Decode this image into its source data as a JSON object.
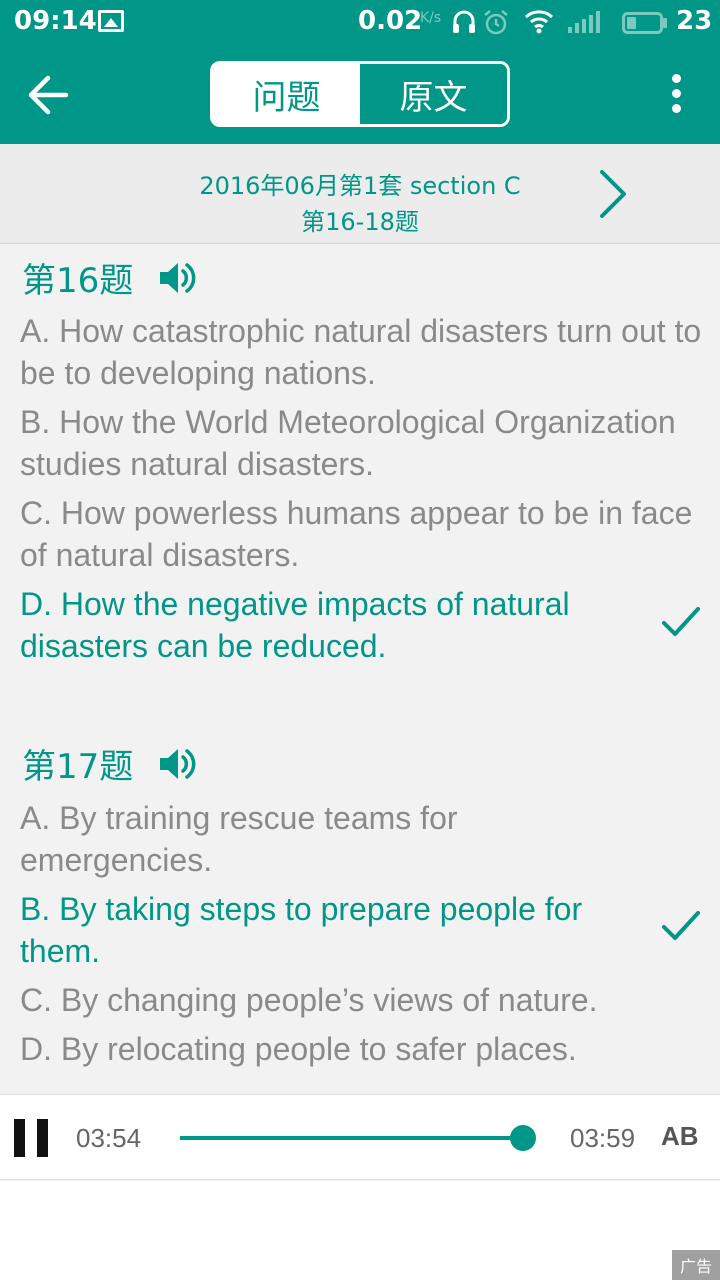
{
  "status_bar": {
    "time": "09:14",
    "net_speed": "0.02",
    "net_speed_unit": "K/s",
    "battery": "23"
  },
  "app_bar": {
    "tabs": [
      {
        "label": "问题",
        "active": true
      },
      {
        "label": "原文",
        "active": false
      }
    ]
  },
  "section": {
    "title": "2016年06月第1套 section C",
    "subtitle": "第16-18题"
  },
  "questions": [
    {
      "title": "第16题",
      "options": [
        {
          "text": "A. How catastrophic natural disasters turn out to be to developing nations.",
          "correct": false
        },
        {
          "text": "B. How the World Meteorological Organization studies natural disasters.",
          "correct": false
        },
        {
          "text": "C. How powerless humans appear to be in face of natural disasters.",
          "correct": false
        },
        {
          "text": "D. How the negative impacts of natural disasters can be reduced.",
          "correct": true
        }
      ]
    },
    {
      "title": "第17题",
      "options": [
        {
          "text": "A. By training rescue teams for emergencies.",
          "correct": false
        },
        {
          "text": "B. By taking steps to prepare people for them.",
          "correct": true
        },
        {
          "text": "C. By changing people’s views of nature.",
          "correct": false
        },
        {
          "text": "D. By relocating people to safer places.",
          "correct": false
        }
      ]
    }
  ],
  "player": {
    "current_time": "03:54",
    "total_time": "03:59",
    "progress": 0.979,
    "ab_label": "AB",
    "accent_color": "#009688"
  },
  "ad": {
    "label": "广告"
  },
  "icons": [
    "back-arrow-icon",
    "speaker-icon",
    "check-icon",
    "chevron-right-icon",
    "more-vert-icon",
    "pause-icon"
  ]
}
